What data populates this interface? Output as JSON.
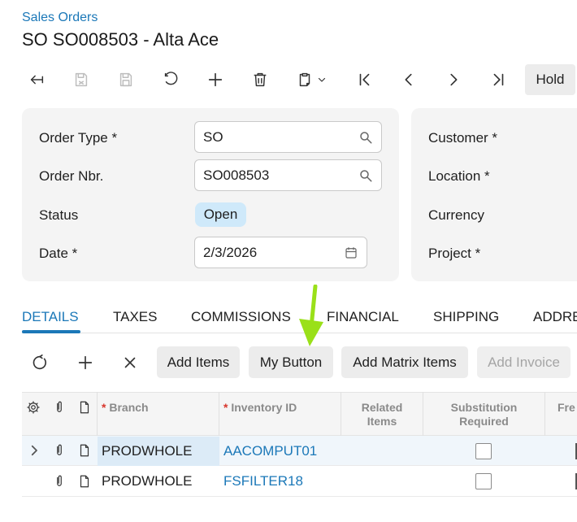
{
  "breadcrumb": "Sales Orders",
  "title": "SO SO008503 - Alta Ace",
  "toolbar": {
    "icons": [
      "back-icon",
      "save-close-icon",
      "save-icon",
      "undo-icon",
      "add-icon",
      "delete-icon",
      "clipboard-icon",
      "first-icon",
      "previous-icon",
      "next-icon",
      "last-icon"
    ],
    "hold_label": "Hold"
  },
  "form": {
    "order_type_label": "Order Type",
    "order_type_value": "SO",
    "order_nbr_label": "Order Nbr.",
    "order_nbr_value": "SO008503",
    "status_label": "Status",
    "status_value": "Open",
    "date_label": "Date",
    "date_value": "2/3/2026",
    "required_mark": "*",
    "customer_label": "Customer",
    "location_label": "Location",
    "currency_label": "Currency",
    "project_label": "Project"
  },
  "tabs": [
    "DETAILS",
    "TAXES",
    "COMMISSIONS",
    "FINANCIAL",
    "SHIPPING",
    "ADDRE"
  ],
  "grid_toolbar": {
    "add_items": "Add Items",
    "my_button": "My Button",
    "add_matrix_items": "Add Matrix Items",
    "add_invoice": "Add Invoice"
  },
  "grid": {
    "columns": {
      "branch": "Branch",
      "inventory_id": "Inventory ID",
      "related_items_1": "Related",
      "related_items_2": "Items",
      "substitution_1": "Substitution",
      "substitution_2": "Required",
      "free": "Fre"
    },
    "rows": [
      {
        "branch": "PRODWHOLE",
        "inventory_id": "AACOMPUT01",
        "substitution_required": false
      },
      {
        "branch": "PRODWHOLE",
        "inventory_id": "FSFILTER18",
        "substitution_required": false
      }
    ]
  },
  "colors": {
    "accent": "#1b78b8",
    "status_pill": "#cfe9fa",
    "annotation_arrow": "#9ae019"
  }
}
